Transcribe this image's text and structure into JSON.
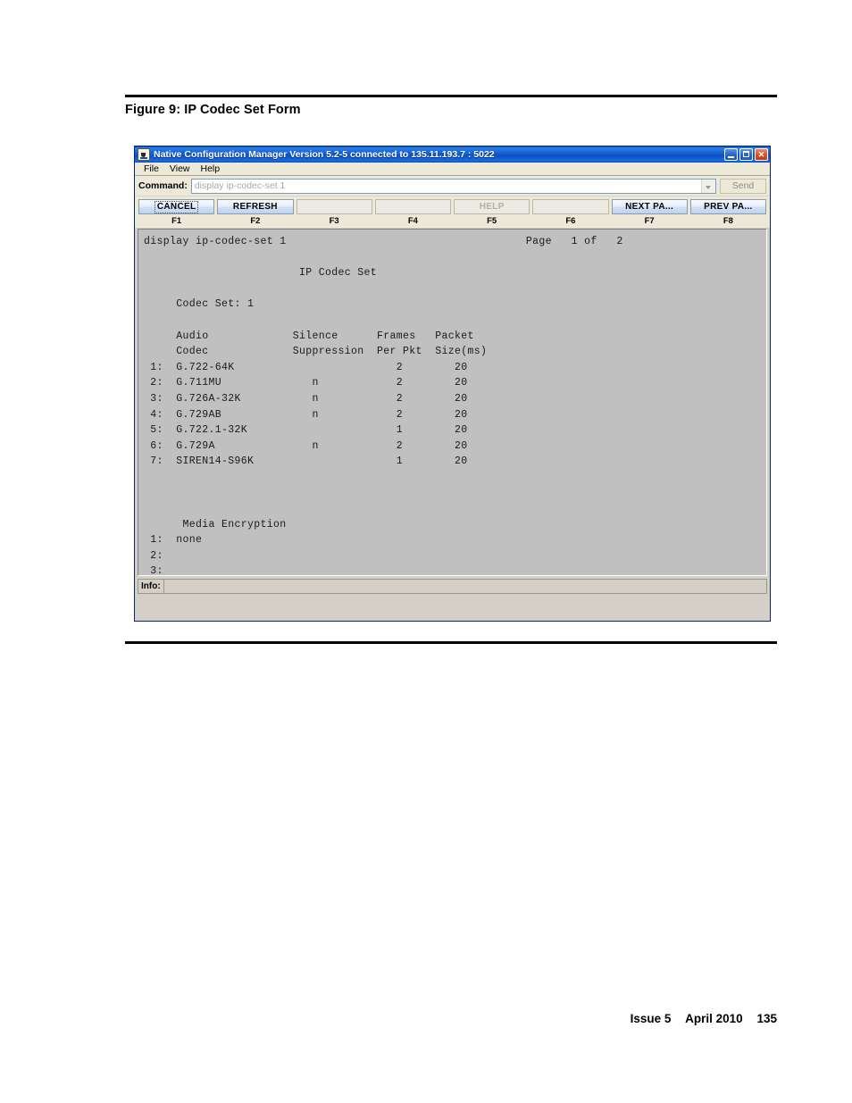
{
  "document": {
    "figure_caption": "Figure 9: IP Codec Set Form",
    "footer": {
      "issue": "Issue 5",
      "date": "April 2010",
      "page_number": "135"
    }
  },
  "window": {
    "title": "Native Configuration Manager Version 5.2-5 connected to 135.11.193.7 : 5022",
    "icon": "java-coffee-cup-icon",
    "controls": {
      "minimize": "minimize-icon",
      "maximize": "maximize-icon",
      "close": "✕"
    },
    "menu": [
      "File",
      "View",
      "Help"
    ]
  },
  "command_bar": {
    "label": "Command:",
    "value": "",
    "placeholder": "display ip-codec-set 1",
    "send_label": "Send",
    "dropdown_icon": "chevron-down-icon"
  },
  "function_keys": [
    {
      "label": "CANCEL",
      "key": "F1",
      "state": "focused"
    },
    {
      "label": "REFRESH",
      "key": "F2",
      "state": "enabled"
    },
    {
      "label": "",
      "key": "F3",
      "state": "empty"
    },
    {
      "label": "",
      "key": "F4",
      "state": "empty"
    },
    {
      "label": "HELP",
      "key": "F5",
      "state": "disabled"
    },
    {
      "label": "",
      "key": "F6",
      "state": "empty"
    },
    {
      "label": "NEXT  PA...",
      "key": "F7",
      "state": "enabled"
    },
    {
      "label": "PREV  PA...",
      "key": "F8",
      "state": "enabled"
    }
  ],
  "terminal": {
    "command_echo": "display ip-codec-set 1",
    "page_indicator": "Page   1 of   2",
    "form_title": "IP Codec Set",
    "codec_set_label": "Codec Set: 1",
    "table_header_line1": "   Audio             Silence      Frames   Packet",
    "table_header_line2": "   Codec             Suppression  Per Pkt  Size(ms)",
    "rows": [
      {
        "index": "1:",
        "codec": "G.722-64K",
        "silence": "",
        "frames": "2",
        "packet_size": "20"
      },
      {
        "index": "2:",
        "codec": "G.711MU",
        "silence": "n",
        "frames": "2",
        "packet_size": "20"
      },
      {
        "index": "3:",
        "codec": "G.726A-32K",
        "silence": "n",
        "frames": "2",
        "packet_size": "20"
      },
      {
        "index": "4:",
        "codec": "G.729AB",
        "silence": "n",
        "frames": "2",
        "packet_size": "20"
      },
      {
        "index": "5:",
        "codec": "G.722.1-32K",
        "silence": "",
        "frames": "1",
        "packet_size": "20"
      },
      {
        "index": "6:",
        "codec": "G.729A",
        "silence": "n",
        "frames": "2",
        "packet_size": "20"
      },
      {
        "index": "7:",
        "codec": "SIREN14-S96K",
        "silence": "",
        "frames": "1",
        "packet_size": "20"
      }
    ],
    "media_encryption_title": "Media Encryption",
    "media_encryption_rows": [
      {
        "index": "1:",
        "value": "none"
      },
      {
        "index": "2:",
        "value": ""
      },
      {
        "index": "3:",
        "value": ""
      }
    ],
    "full_text": "display ip-codec-set 1                                     Page   1 of   2\n\n                        IP Codec Set\n\n     Codec Set: 1\n\n     Audio             Silence      Frames   Packet\n     Codec             Suppression  Per Pkt  Size(ms)\n 1:  G.722-64K                         2        20\n 2:  G.711MU              n            2        20\n 3:  G.726A-32K           n            2        20\n 4:  G.729AB              n            2        20\n 5:  G.722.1-32K                       1        20\n 6:  G.729A               n            2        20\n 7:  SIREN14-S96K                      1        20\n\n\n\n      Media Encryption\n 1:  none\n 2:\n 3:"
  },
  "info_bar": {
    "label": "Info:",
    "value": ""
  },
  "colors": {
    "titlebar_blue": "#0a55c8",
    "window_chrome": "#ece9d8",
    "terminal_bg": "#c0c0c0",
    "close_button_red": "#e2562c"
  }
}
